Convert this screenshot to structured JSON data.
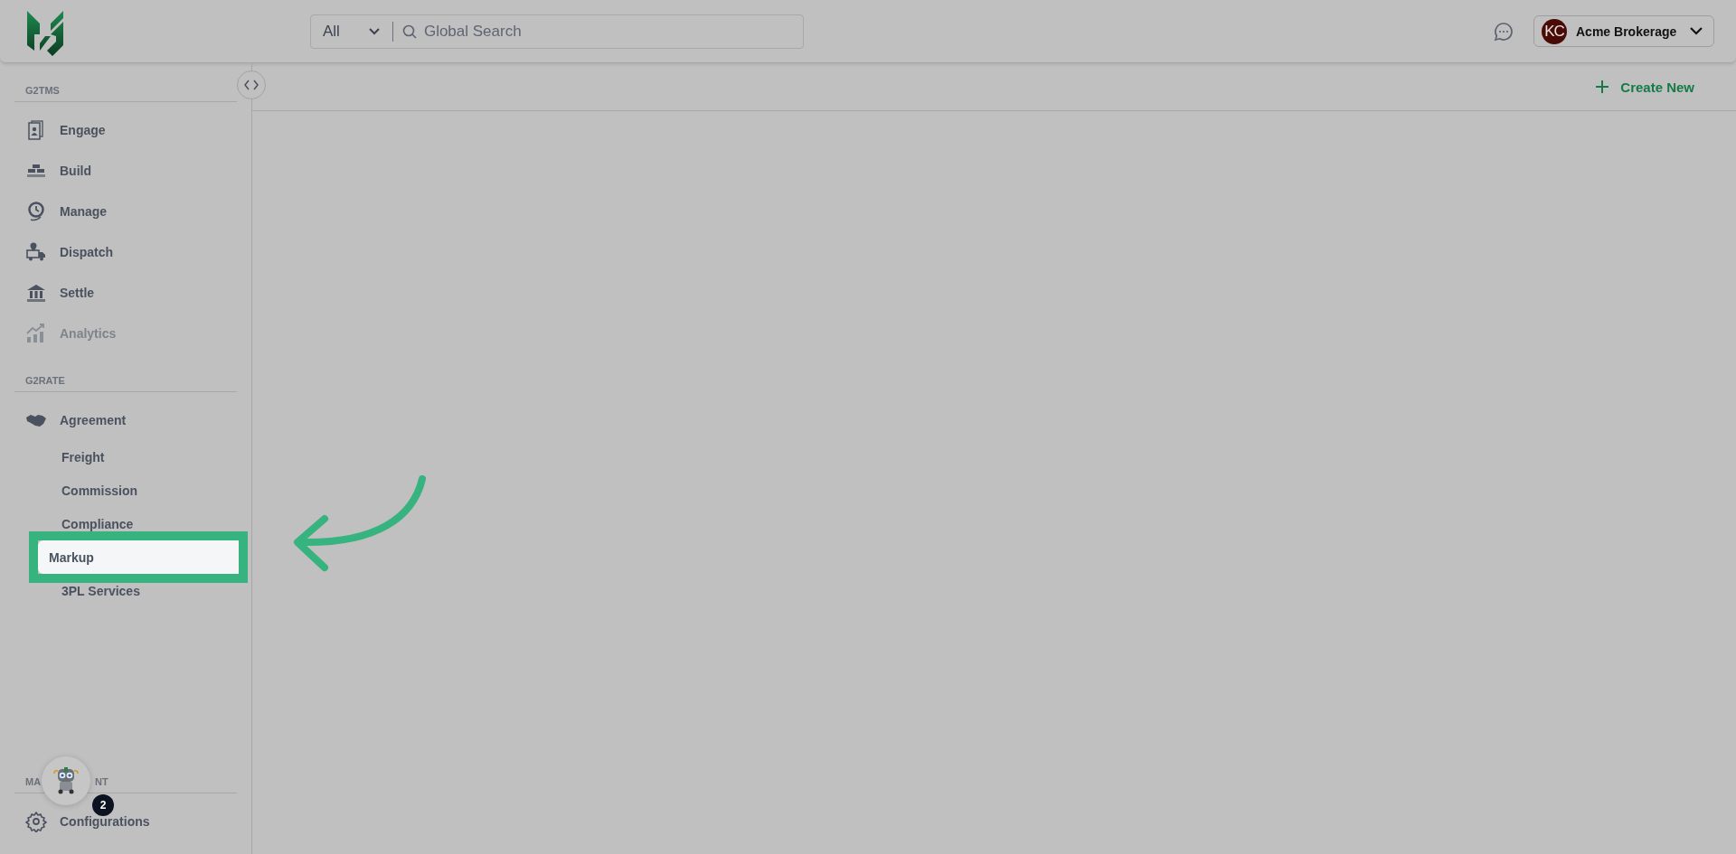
{
  "header": {
    "search": {
      "scope": "All",
      "placeholder": "Global Search"
    },
    "account": {
      "initials": "KC",
      "name": "Acme Brokerage"
    }
  },
  "toolbar": {
    "create_button": "Create New"
  },
  "sidebar": {
    "sections": [
      {
        "title": "G2TMS",
        "items": [
          {
            "label": "Engage",
            "kind": "icon",
            "disabled": false,
            "selected": false
          },
          {
            "label": "Build",
            "kind": "icon",
            "disabled": false,
            "selected": false
          },
          {
            "label": "Manage",
            "kind": "icon",
            "disabled": false,
            "selected": false
          },
          {
            "label": "Dispatch",
            "kind": "icon",
            "disabled": false,
            "selected": false
          },
          {
            "label": "Settle",
            "kind": "icon",
            "disabled": false,
            "selected": false
          },
          {
            "label": "Analytics",
            "kind": "icon",
            "disabled": true,
            "selected": false
          }
        ]
      },
      {
        "title": "G2RATE",
        "items": [
          {
            "label": "Agreement",
            "kind": "icon",
            "disabled": false,
            "selected": false
          },
          {
            "label": "Freight",
            "kind": "sub",
            "disabled": false,
            "selected": false
          },
          {
            "label": "Commission",
            "kind": "sub",
            "disabled": false,
            "selected": false
          },
          {
            "label": "Compliance",
            "kind": "sub",
            "disabled": false,
            "selected": false
          },
          {
            "label": "Markup",
            "kind": "sub",
            "disabled": false,
            "selected": true
          },
          {
            "label": "3PL Services",
            "kind": "sub",
            "disabled": false,
            "selected": false
          }
        ]
      }
    ],
    "bottom_section": {
      "title_start": "MA",
      "title_end": "NT",
      "items": [
        {
          "label": "Configurations",
          "kind": "icon",
          "disabled": false,
          "selected": false
        }
      ]
    }
  },
  "assistant": {
    "badge": "2"
  }
}
